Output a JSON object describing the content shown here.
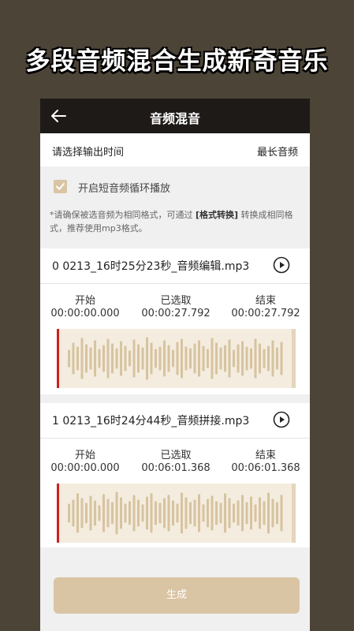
{
  "banner": {
    "title": "多段音频混合生成新奇音乐"
  },
  "header": {
    "title": "音频混音",
    "back_icon": "back-arrow-icon"
  },
  "output": {
    "label": "请选择输出时间",
    "value": "最长音频"
  },
  "loop": {
    "label": "开启短音频循环播放",
    "checked": true
  },
  "note": {
    "text_before": "*请确保被选音频为相同格式，可通过 ",
    "link": "[格式转换]",
    "text_after": " 转换成相同格式，推荐使用mp3格式。"
  },
  "tracks": [
    {
      "name": "0  0213_16时25分23秒_音频编辑.mp3",
      "start_label": "开始",
      "start": "00:00:00.000",
      "selected_label": "已选取",
      "selected": "00:00:27.792",
      "end_label": "结束",
      "end": "00:00:27.792"
    },
    {
      "name": "1  0213_16时24分44秒_音频拼接.mp3",
      "start_label": "开始",
      "start": "00:00:00.000",
      "selected_label": "已选取",
      "selected": "00:06:01.368",
      "end_label": "结束",
      "end": "00:06:01.368"
    }
  ],
  "generate": {
    "label": "生成"
  },
  "colors": {
    "accent": "#d9c4a3",
    "waveform": "#d6c3a0",
    "playhead": "#cc1f1f",
    "topbar": "#1e1a17",
    "background": "#4c4437"
  }
}
